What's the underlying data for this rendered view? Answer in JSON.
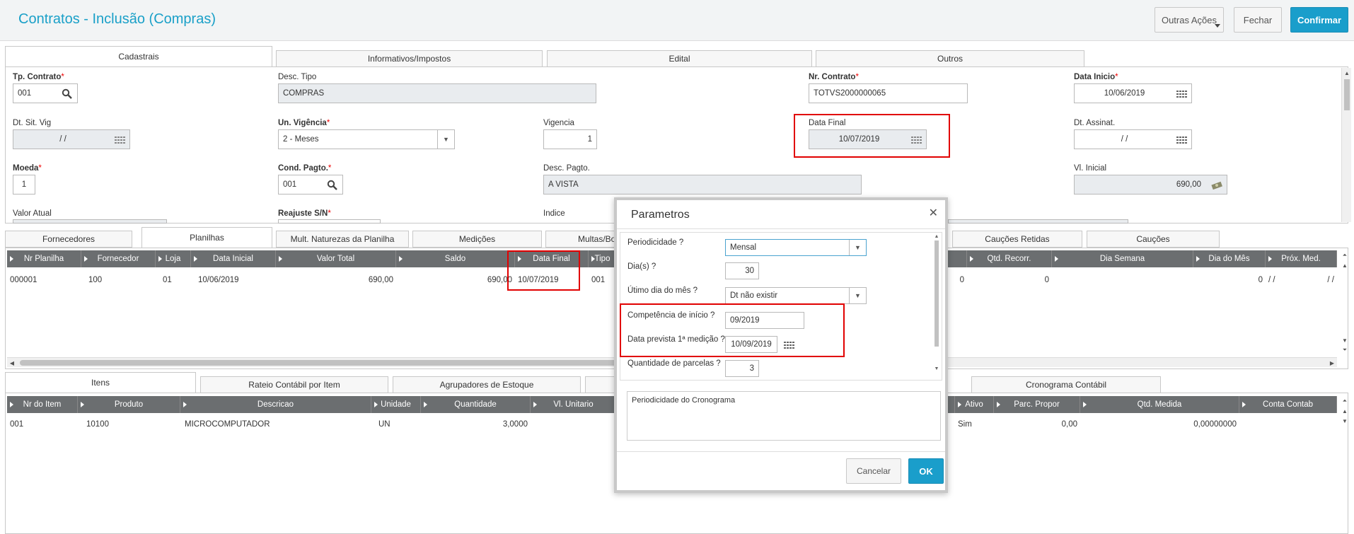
{
  "header": {
    "title": "Contratos - Inclusão (Compras)",
    "outras_acoes": "Outras Ações",
    "fechar": "Fechar",
    "confirmar": "Confirmar"
  },
  "top_tabs": [
    "Cadastrais",
    "Informativos/Impostos",
    "Edital",
    "Outros"
  ],
  "form": {
    "tp_contrato_label": "Tp. Contrato",
    "tp_contrato": "001",
    "desc_tipo_label": "Desc. Tipo",
    "desc_tipo": "COMPRAS",
    "nr_contrato_label": "Nr. Contrato",
    "nr_contrato": "TOTVS2000000065",
    "data_inicio_label": "Data Inicio",
    "data_inicio": "10/06/2019",
    "dt_sit_vig_label": "Dt. Sit. Vig",
    "dt_sit_vig": "/  /",
    "un_vigencia_label": "Un. Vigência",
    "un_vigencia": "2 - Meses",
    "vigencia_label": "Vigencia",
    "vigencia": "1",
    "data_final_label": "Data Final",
    "data_final": "10/07/2019",
    "dt_assinat_label": "Dt. Assinat.",
    "dt_assinat": "/  /",
    "moeda_label": "Moeda",
    "moeda": "1",
    "cond_pagto_label": "Cond. Pagto.",
    "cond_pagto": "001",
    "desc_pagto_label": "Desc. Pagto.",
    "desc_pagto": "A VISTA",
    "vl_inicial_label": "Vl. Inicial",
    "vl_inicial": "690,00",
    "valor_atual_label": "Valor Atual",
    "reajuste_label": "Reajuste S/N",
    "indice_label": "Indice"
  },
  "mid_tabs": [
    "Fornecedores",
    "Planilhas",
    "Mult. Naturezas da Planilha",
    "Medições",
    "Multas/Bon",
    "Cauções Retidas",
    "Cauções"
  ],
  "planilhas": {
    "columns": [
      "Nr Planilha",
      "Fornecedor",
      "Loja",
      "Data Inicial",
      "Valor Total",
      "Saldo",
      "Data Final",
      "Tipo",
      "Qtd. Recorr.",
      "Dia Semana",
      "Dia do Mês",
      "Próx. Med."
    ],
    "row": {
      "nr_planilha": "000001",
      "fornecedor": "100",
      "loja": "01",
      "data_inicial": "10/06/2019",
      "valor_total": "690,00",
      "saldo": "690,00",
      "data_final": "10/07/2019",
      "tipo": "001",
      "extra": "0",
      "qtd_recorr": "0",
      "dia_semana": "",
      "dia_mes": "0",
      "prox_med1": "/  /",
      "prox_med2": "/  /"
    }
  },
  "bottom_tabs": [
    "Itens",
    "Rateio Contábil por Item",
    "Agrupadores de Estoque",
    "Cronograma Contábil"
  ],
  "itens": {
    "columns": [
      "Nr do Item",
      "Produto",
      "Descricao",
      "Unidade",
      "Quantidade",
      "Vl. Unitario",
      "Ativo",
      "Parc. Propor",
      "Qtd. Medida",
      "Conta Contab"
    ],
    "row": {
      "nr_item": "001",
      "produto": "10100",
      "descricao": "MICROCOMPUTADOR",
      "unidade": "UN",
      "quantidade": "3,0000",
      "ativo": "Sim",
      "parc_propor": "0,00",
      "qtd_medida": "0,00000000"
    }
  },
  "modal": {
    "title": "Parametros",
    "periodicidade_label": "Periodicidade ?",
    "periodicidade": "Mensal",
    "dias_label": "Dia(s) ?",
    "dias": "30",
    "ultimo_dia_label": "Útimo dia do mês ?",
    "ultimo_dia": "Dt não existir",
    "competencia_label": "Competência de início ?",
    "competencia": "09/2019",
    "data_prevista_label": "Data prevista 1ª medição ?",
    "data_prevista": "10/09/2019",
    "qtd_parcelas_label": "Quantidade de parcelas ?",
    "qtd_parcelas": "3",
    "descricao": "Periodicidade do Cronograma",
    "cancelar": "Cancelar",
    "ok": "OK"
  },
  "colors": {
    "accent": "#1a9ecb",
    "highlight": "#e10000",
    "grid_header": "#6b6e70"
  }
}
